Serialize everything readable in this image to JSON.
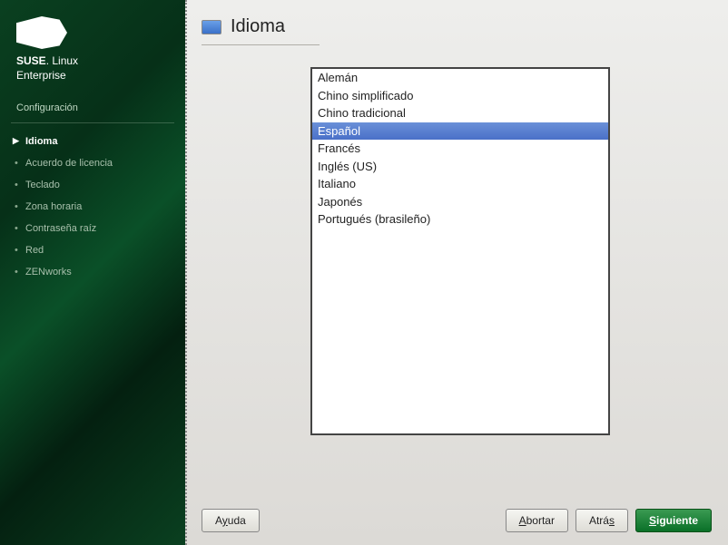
{
  "brand": {
    "line1_strong": "SUSE",
    "line1_light": ". Linux",
    "line2": "Enterprise"
  },
  "sidebar": {
    "section": "Configuración",
    "steps": [
      {
        "label": "Idioma",
        "active": true
      },
      {
        "label": "Acuerdo de licencia",
        "active": false
      },
      {
        "label": "Teclado",
        "active": false
      },
      {
        "label": "Zona horaria",
        "active": false
      },
      {
        "label": "Contraseña raíz",
        "active": false
      },
      {
        "label": "Red",
        "active": false
      },
      {
        "label": "ZENworks",
        "active": false
      }
    ]
  },
  "page": {
    "title": "Idioma"
  },
  "languages": {
    "items": [
      {
        "label": "Alemán",
        "selected": false
      },
      {
        "label": "Chino simplificado",
        "selected": false
      },
      {
        "label": "Chino tradicional",
        "selected": false
      },
      {
        "label": "Español",
        "selected": true
      },
      {
        "label": "Francés",
        "selected": false
      },
      {
        "label": "Inglés (US)",
        "selected": false
      },
      {
        "label": "Italiano",
        "selected": false
      },
      {
        "label": "Japonés",
        "selected": false
      },
      {
        "label": "Portugués (brasileño)",
        "selected": false
      }
    ]
  },
  "buttons": {
    "help": "Ayuda",
    "abort": "Abortar",
    "back": "Atrás",
    "next": "Siguiente"
  }
}
